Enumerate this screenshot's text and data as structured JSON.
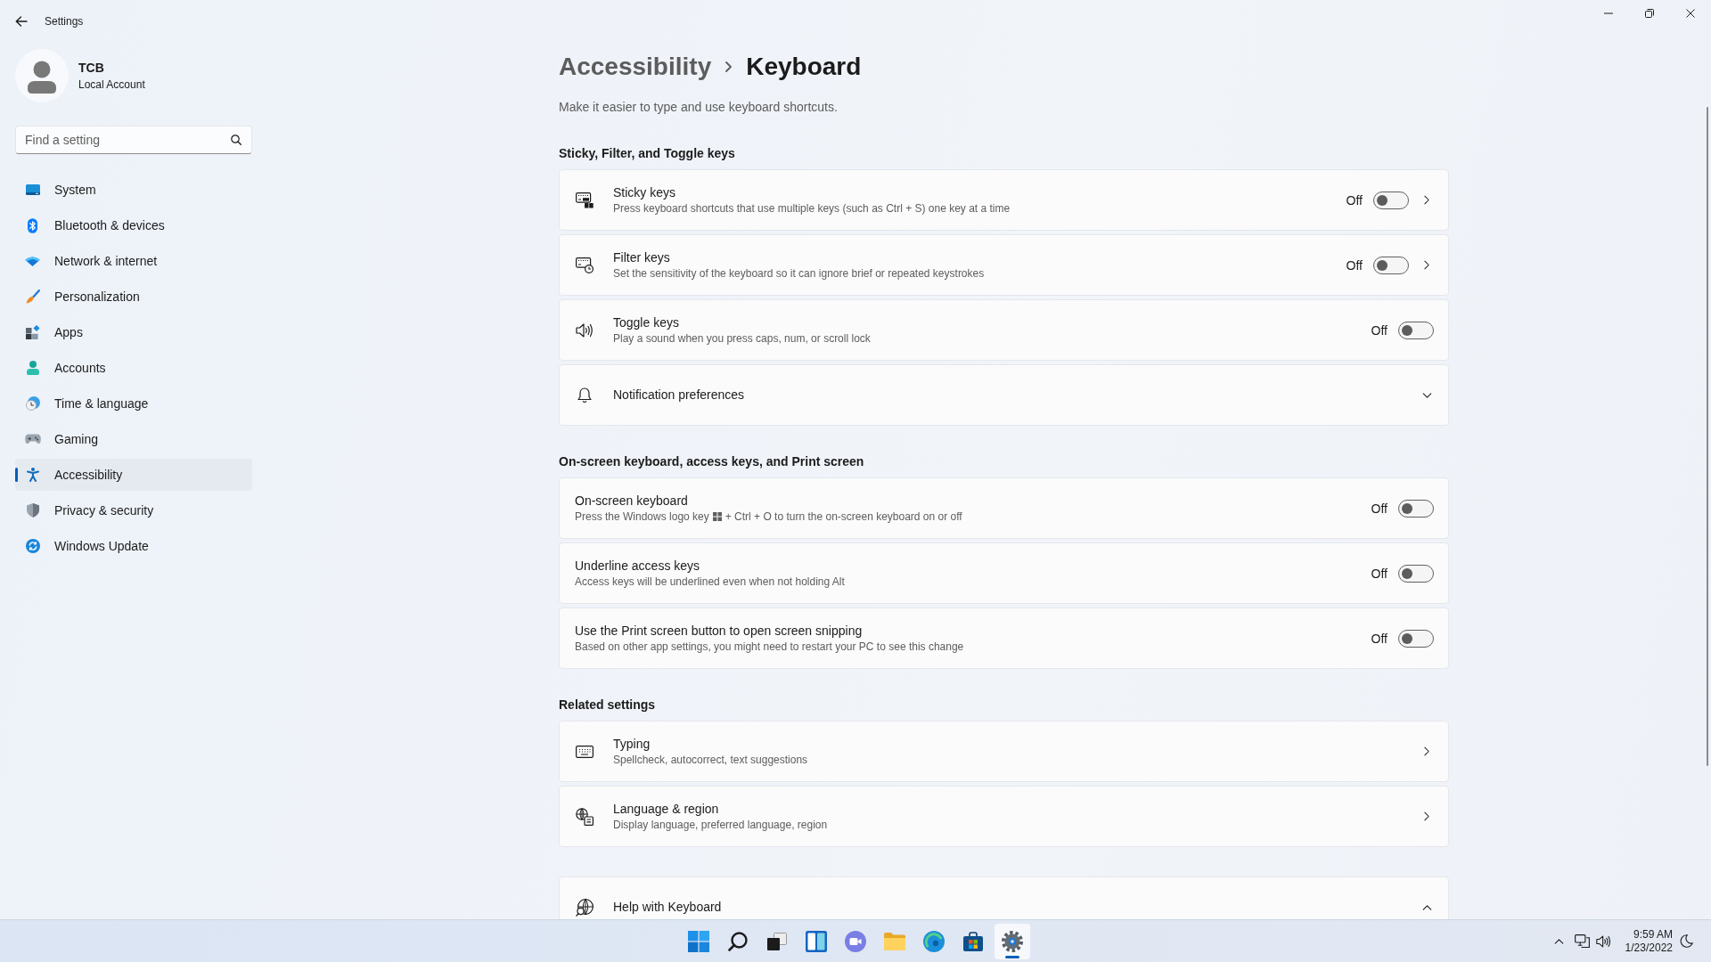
{
  "window": {
    "title": "Settings"
  },
  "account": {
    "name": "TCB",
    "type": "Local Account"
  },
  "search": {
    "placeholder": "Find a setting"
  },
  "nav": [
    {
      "label": "System",
      "selected": false
    },
    {
      "label": "Bluetooth & devices",
      "selected": false
    },
    {
      "label": "Network & internet",
      "selected": false
    },
    {
      "label": "Personalization",
      "selected": false
    },
    {
      "label": "Apps",
      "selected": false
    },
    {
      "label": "Accounts",
      "selected": false
    },
    {
      "label": "Time & language",
      "selected": false
    },
    {
      "label": "Gaming",
      "selected": false
    },
    {
      "label": "Accessibility",
      "selected": true
    },
    {
      "label": "Privacy & security",
      "selected": false
    },
    {
      "label": "Windows Update",
      "selected": false
    }
  ],
  "breadcrumb": {
    "parent": "Accessibility",
    "current": "Keyboard"
  },
  "subtitle": "Make it easier to type and use keyboard shortcuts.",
  "sections": [
    {
      "title": "Sticky, Filter, and Toggle keys",
      "rows": [
        {
          "kind": "toggle_link",
          "title": "Sticky keys",
          "description": "Press keyboard shortcuts that use multiple keys (such as Ctrl + S) one key at a time",
          "state_text": "Off",
          "on": false
        },
        {
          "kind": "toggle_link",
          "title": "Filter keys",
          "description": "Set the sensitivity of the keyboard so it can ignore brief or repeated keystrokes",
          "state_text": "Off",
          "on": false
        },
        {
          "kind": "toggle",
          "title": "Toggle keys",
          "description": "Play a sound when you press caps, num, or scroll lock",
          "state_text": "Off",
          "on": false
        },
        {
          "kind": "expander",
          "title": "Notification preferences",
          "expanded": false
        }
      ]
    },
    {
      "title": "On-screen keyboard, access keys, and Print screen",
      "rows": [
        {
          "kind": "toggle",
          "title": "On-screen keyboard",
          "description": "Press the Windows logo key",
          "description_after": "+ Ctrl + O to turn the on-screen keyboard on or off",
          "state_text": "Off",
          "on": false
        },
        {
          "kind": "toggle",
          "title": "Underline access keys",
          "description": "Access keys will be underlined even when not holding Alt",
          "state_text": "Off",
          "on": false
        },
        {
          "kind": "toggle",
          "title": "Use the Print screen button to open screen snipping",
          "description": "Based on other app settings, you might need to restart your PC to see this change",
          "state_text": "Off",
          "on": false
        }
      ]
    },
    {
      "title": "Related settings",
      "rows": [
        {
          "kind": "link",
          "title": "Typing",
          "description": "Spellcheck, autocorrect, text suggestions"
        },
        {
          "kind": "link",
          "title": "Language & region",
          "description": "Display language, preferred language, region"
        }
      ]
    },
    {
      "rows": [
        {
          "kind": "expander",
          "title": "Help with Keyboard",
          "expanded": true
        }
      ]
    }
  ],
  "taskbar": {
    "apps": [
      {
        "selected": false
      },
      {
        "selected": false
      },
      {
        "selected": false
      },
      {
        "selected": false
      },
      {
        "selected": false
      },
      {
        "selected": false
      },
      {
        "selected": false
      },
      {
        "selected": false
      },
      {
        "selected": true
      }
    ],
    "time": "9:59 AM",
    "date": "1/23/2022"
  }
}
